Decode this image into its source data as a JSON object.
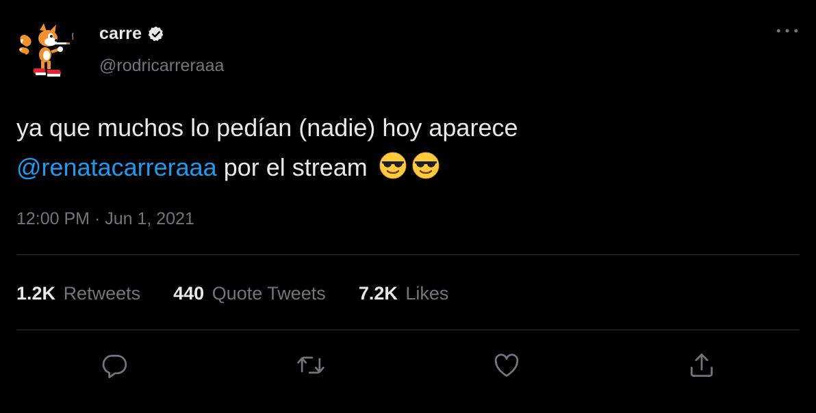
{
  "author": {
    "display_name": "carre",
    "handle": "@rodricarreraaa",
    "verified": true
  },
  "tweet": {
    "text_line1": "ya que muchos lo pedían (nadie) hoy aparece",
    "mention": "@renatacarreraaa",
    "text_line2_rest": " por el stream",
    "emojis": [
      "smiling-face-with-sunglasses",
      "smiling-face-with-sunglasses"
    ]
  },
  "timestamp": "12:00 PM · Jun 1, 2021",
  "stats": {
    "retweets_count": "1.2K",
    "retweets_label": "Retweets",
    "quotes_count": "440",
    "quotes_label": "Quote Tweets",
    "likes_count": "7.2K",
    "likes_label": "Likes"
  },
  "colors": {
    "background": "#000000",
    "text": "#e7e9ea",
    "secondary": "#71767b",
    "accent": "#1d9bf0",
    "divider": "#2f3336"
  },
  "icons": {
    "more": "more-horizontal-icon",
    "reply": "reply-icon",
    "retweet": "retweet-icon",
    "like": "heart-icon",
    "share": "share-icon"
  }
}
